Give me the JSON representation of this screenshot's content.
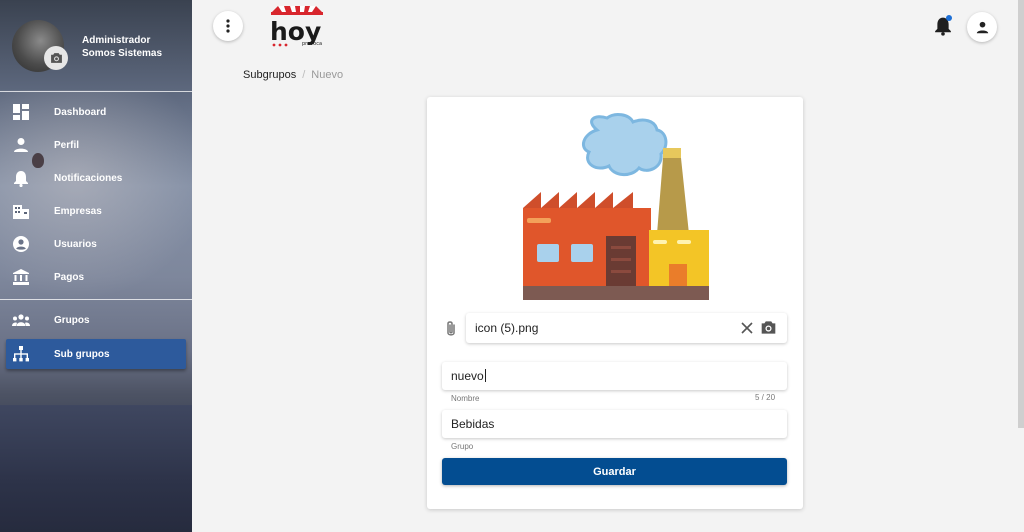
{
  "profile": {
    "role": "Administrador",
    "company": "Somos Sistemas"
  },
  "sidebar": {
    "items": [
      {
        "label": "Dashboard",
        "icon": "dashboard-icon"
      },
      {
        "label": "Perfil",
        "icon": "person-icon"
      },
      {
        "label": "Notificaciones",
        "icon": "bell-icon"
      },
      {
        "label": "Empresas",
        "icon": "building-icon"
      },
      {
        "label": "Usuarios",
        "icon": "account-circle-icon"
      },
      {
        "label": "Pagos",
        "icon": "bank-icon"
      },
      {
        "label": "Grupos",
        "icon": "group-icon"
      },
      {
        "label": "Sub grupos",
        "icon": "hierarchy-icon",
        "active": true
      }
    ]
  },
  "header": {
    "logo_text": "hoy",
    "logo_tagline": "provoca",
    "notification_dot_color": "#1d6fd6"
  },
  "breadcrumb": {
    "parent": "Subgrupos",
    "separator": "/",
    "current": "Nuevo"
  },
  "form": {
    "image_file": "icon (5).png",
    "nombre_value": "nuevo",
    "nombre_hint": "Nombre",
    "nombre_counter": "5 / 20",
    "grupo_value": "Bebidas",
    "grupo_hint": "Grupo",
    "save_label": "Guardar"
  },
  "colors": {
    "accent": "#034d91",
    "active_nav": "#2d5a9c"
  }
}
